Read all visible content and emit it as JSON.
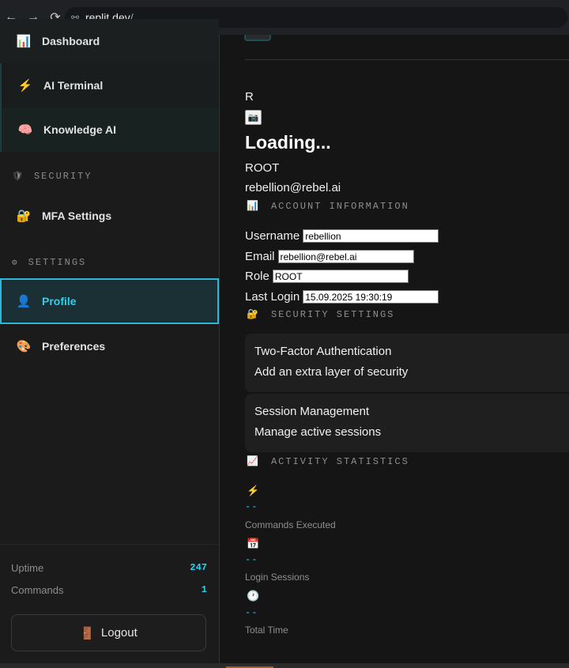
{
  "browser": {
    "url_host": ".replit.dev",
    "url_path": "/"
  },
  "sidebar": {
    "items": [
      {
        "label": "Dashboard",
        "icon": "chart-icon",
        "glyph": "📊"
      },
      {
        "label": "AI Terminal",
        "icon": "lightning-icon",
        "glyph": "⚡"
      },
      {
        "label": "Knowledge AI",
        "icon": "brain-icon",
        "glyph": "🧠"
      },
      {
        "label": "MFA Settings",
        "icon": "lock-icon",
        "glyph": "🔐"
      },
      {
        "label": "Profile",
        "icon": "user-icon",
        "glyph": "👤"
      },
      {
        "label": "Preferences",
        "icon": "palette-icon",
        "glyph": "🎨"
      }
    ],
    "sections": {
      "security": {
        "label": "SECURITY",
        "glyph": "🛡"
      },
      "settings": {
        "label": "SETTINGS",
        "glyph": "⚙"
      }
    },
    "footer": {
      "uptime_label": "Uptime",
      "uptime_value": "247",
      "commands_label": "Commands",
      "commands_value": "1",
      "logout_label": "Logout",
      "logout_glyph": "🚪"
    }
  },
  "profile": {
    "avatar_letter": "R",
    "camera_glyph": "📷",
    "name": "Loading...",
    "role": "ROOT",
    "email": "rebellion@rebel.ai"
  },
  "account_info": {
    "heading": "ACCOUNT INFORMATION",
    "glyph": "📊",
    "fields": {
      "username_label": "Username",
      "username_value": "rebellion",
      "email_label": "Email",
      "email_value": "rebellion@rebel.ai",
      "role_label": "Role",
      "role_value": "ROOT",
      "last_login_label": "Last Login",
      "last_login_value": "15.09.2025 19:30:19"
    }
  },
  "security_settings": {
    "heading": "SECURITY SETTINGS",
    "glyph": "🔐",
    "cards": [
      {
        "title": "Two-Factor Authentication",
        "subtitle": "Add an extra layer of security"
      },
      {
        "title": "Session Management",
        "subtitle": "Manage active sessions"
      }
    ]
  },
  "activity": {
    "heading": "ACTIVITY STATISTICS",
    "glyph": "📈",
    "stats": [
      {
        "glyph": "⚡",
        "value": "--",
        "label": "Commands Executed"
      },
      {
        "glyph": "📅",
        "value": "--",
        "label": "Login Sessions"
      },
      {
        "glyph": "🕐",
        "value": "--",
        "label": "Total Time"
      }
    ]
  },
  "colors": {
    "accent": "#2fd0ee",
    "background": "#151515",
    "sidebar": "#1b1b1b"
  }
}
